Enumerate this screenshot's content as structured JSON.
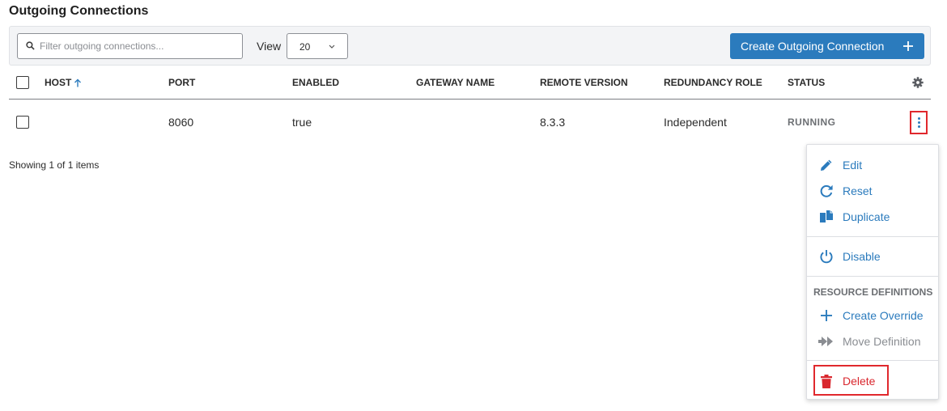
{
  "page": {
    "title": "Outgoing Connections"
  },
  "toolbar": {
    "search_placeholder": "Filter outgoing connections...",
    "view_label": "View",
    "view_value": "20",
    "create_label": "Create Outgoing Connection"
  },
  "table": {
    "columns": [
      "HOST",
      "PORT",
      "ENABLED",
      "GATEWAY NAME",
      "REMOTE VERSION",
      "REDUNDANCY ROLE",
      "STATUS"
    ],
    "sort": {
      "column": "HOST",
      "direction": "ascending"
    },
    "rows": [
      {
        "host": "",
        "port": "8060",
        "enabled": "true",
        "gateway_name": "",
        "remote_version": "8.3.3",
        "redundancy_role": "Independent",
        "status": "RUNNING"
      }
    ],
    "footer": "Showing 1 of 1 items"
  },
  "menu": {
    "edit": "Edit",
    "reset": "Reset",
    "duplicate": "Duplicate",
    "disable": "Disable",
    "section_label": "RESOURCE DEFINITIONS",
    "create_override": "Create Override",
    "move_definition": "Move Definition",
    "delete": "Delete"
  },
  "colors": {
    "accent": "#2b7bbd",
    "danger": "#d9272e",
    "highlight_outline": "#e0282d",
    "status_text": "#6c6f73"
  },
  "icons": {
    "search": "search-icon",
    "dropdown": "chevron-down-icon",
    "create": "plus-icon",
    "sort": "arrow-up-icon",
    "settings": "gear-icon",
    "row_actions": "kebab-menu-icon",
    "edit": "pencil-icon",
    "reset": "refresh-icon",
    "duplicate": "copy-icon",
    "disable": "power-icon",
    "create_override": "plus-icon",
    "move_definition": "double-arrow-right-icon",
    "delete": "trash-icon"
  }
}
